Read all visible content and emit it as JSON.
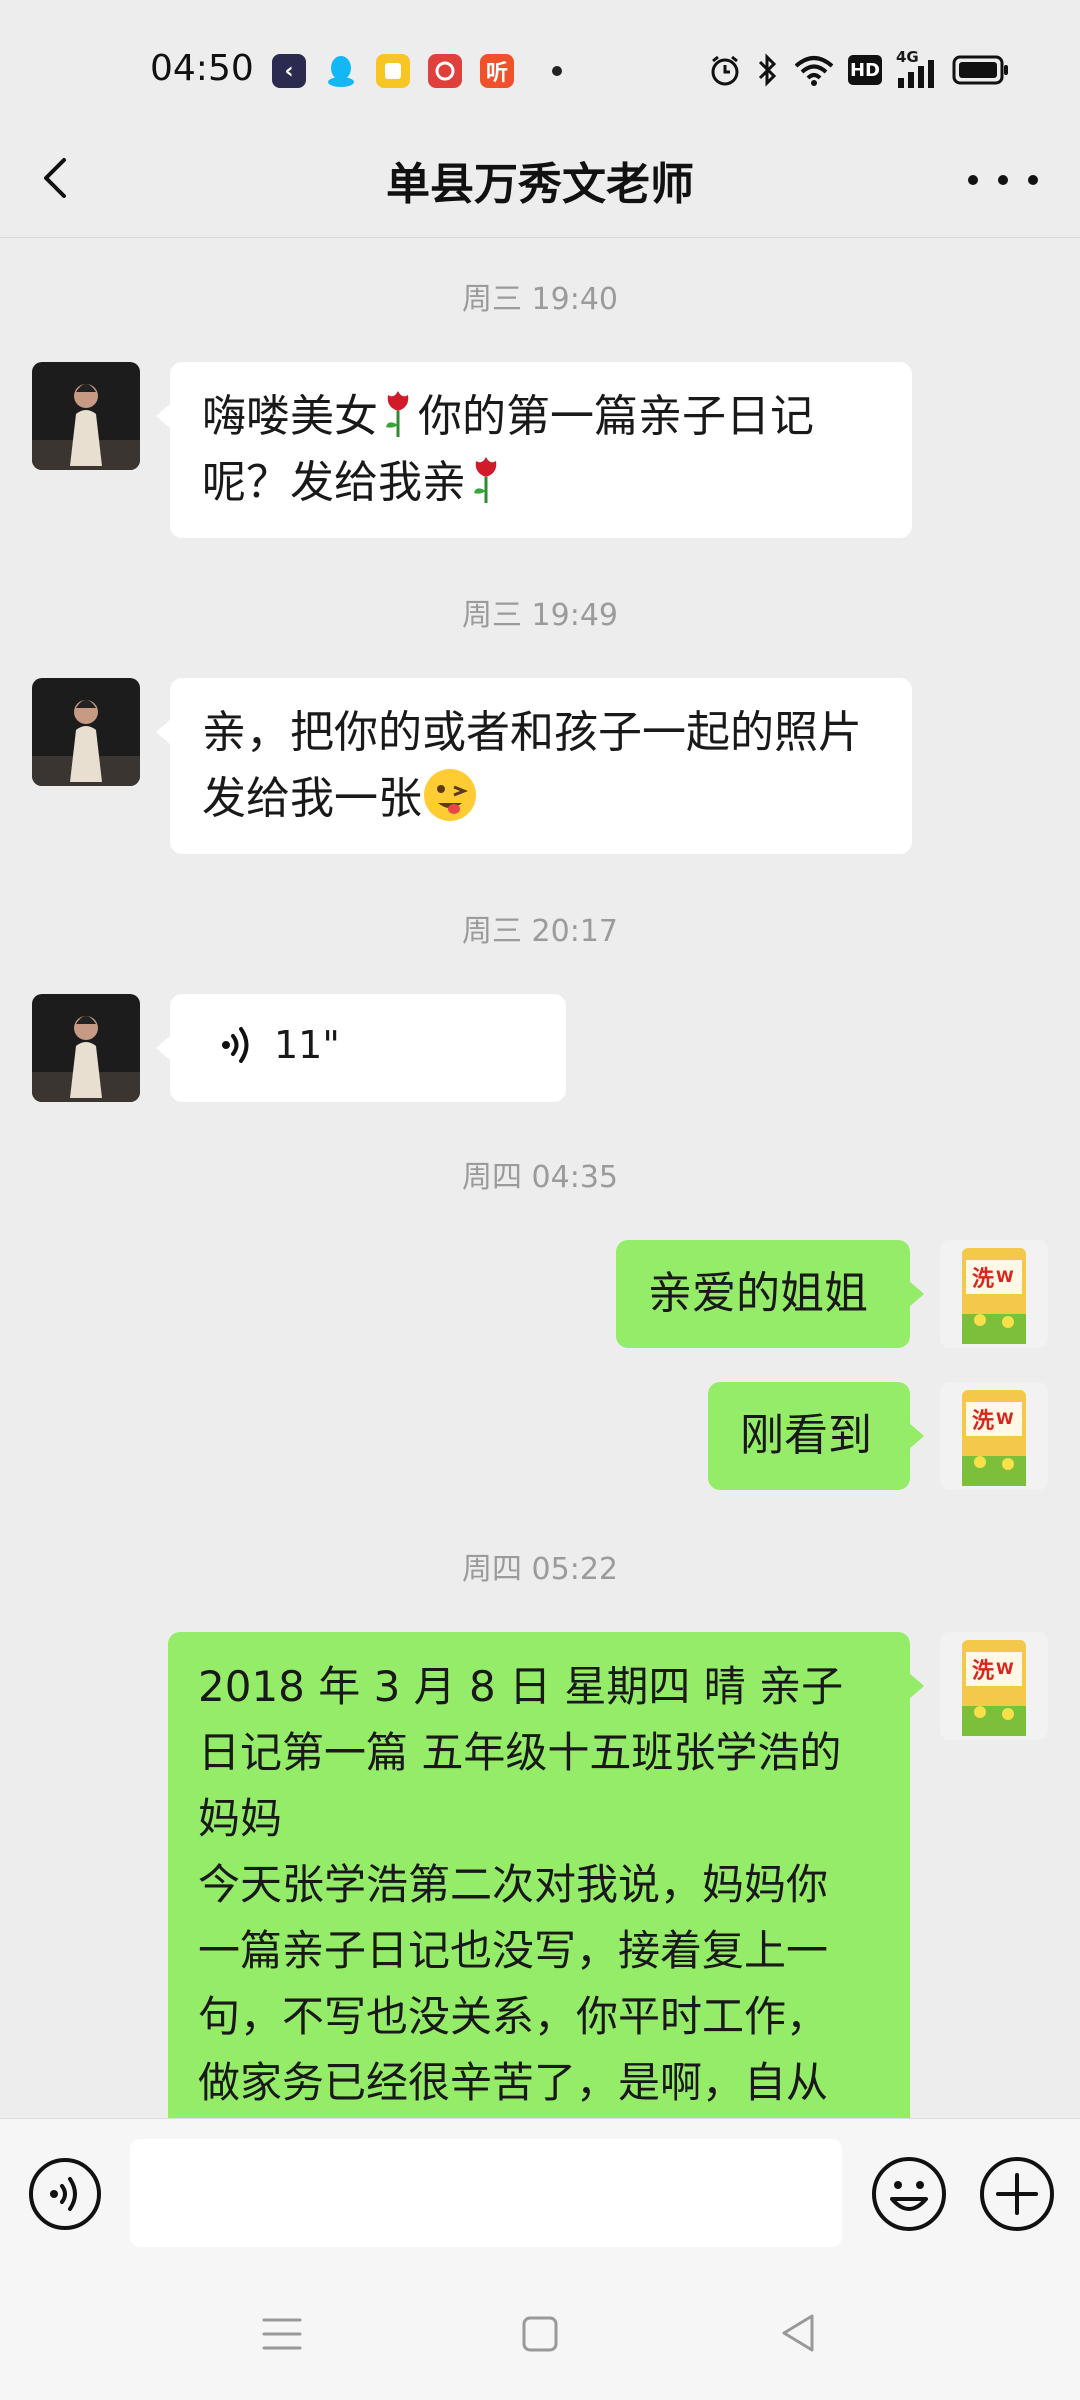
{
  "status_bar": {
    "time": "04:50",
    "notification_apps": [
      "back-app-icon",
      "qq-icon",
      "notes-icon",
      "netease-icon",
      "ting-icon"
    ],
    "ting_label": "听",
    "network_label": "HD",
    "signal_label": "4G"
  },
  "header": {
    "title": "单县万秀文老师"
  },
  "chat": {
    "messages": [
      {
        "type": "timestamp",
        "text": "周三 19:40"
      },
      {
        "type": "text",
        "from": "contact",
        "parts": [
          "嗨喽美女",
          "你的第一篇亲子日记呢？发给我亲"
        ]
      },
      {
        "type": "timestamp",
        "text": "周三 19:49"
      },
      {
        "type": "text",
        "from": "contact",
        "parts": [
          "亲，把你的或者和孩子一起的照片发给我一张"
        ]
      },
      {
        "type": "timestamp",
        "text": "周三 20:17"
      },
      {
        "type": "voice",
        "from": "contact",
        "duration": "11\""
      },
      {
        "type": "timestamp",
        "text": "周四 04:35"
      },
      {
        "type": "text",
        "from": "me",
        "text": "亲爱的姐姐"
      },
      {
        "type": "text",
        "from": "me",
        "text": "刚看到"
      },
      {
        "type": "timestamp",
        "text": "周四 05:22"
      },
      {
        "type": "text",
        "from": "me",
        "lines": [
          "2018 年 3 月 8 日  星期四   晴 亲子",
          "日记第一篇 五年级十五班张学浩的",
          "妈妈",
          "今天张学浩第二次对我说，妈妈你",
          "一篇亲子日记也没写，接着复上一",
          "句，不写也没关系，你平时工作，",
          "做家务已经很辛苦了，是啊，自从"
        ]
      }
    ]
  },
  "input_bar": {
    "placeholder": ""
  },
  "colors": {
    "background": "#ededed",
    "my_bubble": "#95ec69",
    "their_bubble": "#ffffff",
    "timestamp": "#9b9b9b"
  }
}
